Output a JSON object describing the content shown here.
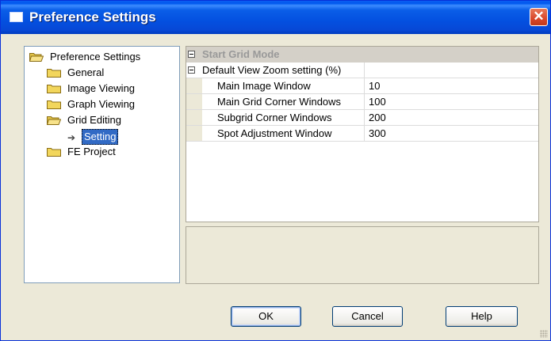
{
  "window": {
    "title": "Preference Settings",
    "close_label": "✕"
  },
  "tree": {
    "root": "Preference Settings",
    "items": [
      {
        "label": "General"
      },
      {
        "label": "Image Viewing"
      },
      {
        "label": "Graph Viewing"
      },
      {
        "label": "Grid Editing"
      },
      {
        "label": "Setting",
        "selected": true
      },
      {
        "label": "FE Project"
      }
    ]
  },
  "grid": {
    "category": "Start Grid Mode",
    "group": "Default View Zoom setting (%)",
    "rows": [
      {
        "name": "Main Image Window",
        "value": "10"
      },
      {
        "name": "Main Grid Corner Windows",
        "value": "100"
      },
      {
        "name": "Subgrid Corner Windows",
        "value": "200"
      },
      {
        "name": "Spot Adjustment Window",
        "value": "300"
      }
    ]
  },
  "buttons": {
    "ok": "OK",
    "cancel": "Cancel",
    "help": "Help"
  },
  "colors": {
    "title_bar": "#0450e0",
    "selection": "#316ac5",
    "folder": "#f2d65c",
    "close": "#d9472a",
    "category_bg": "#d4d0c8"
  }
}
